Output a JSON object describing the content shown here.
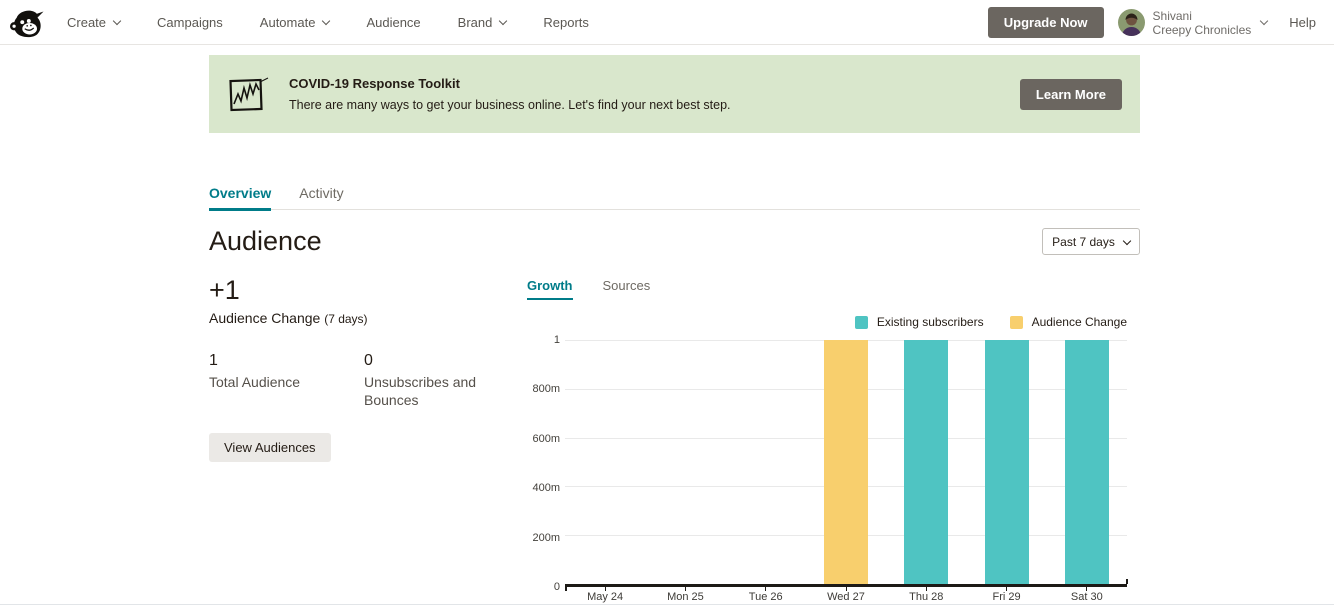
{
  "nav": {
    "items": [
      {
        "label": "Create",
        "chevron": true
      },
      {
        "label": "Campaigns",
        "chevron": false
      },
      {
        "label": "Automate",
        "chevron": true
      },
      {
        "label": "Audience",
        "chevron": false
      },
      {
        "label": "Brand",
        "chevron": true
      },
      {
        "label": "Reports",
        "chevron": false
      }
    ],
    "upgrade_label": "Upgrade Now",
    "user": {
      "name": "Shivani",
      "org": "Creepy Chronicles"
    },
    "help_label": "Help"
  },
  "banner": {
    "icon": "chart-sketch-icon",
    "title": "COVID-19 Response Toolkit",
    "description": "There are many ways to get your business online. Let's find your next best step.",
    "cta": "Learn More",
    "bg_color": "#d9e7cc"
  },
  "tabs": [
    {
      "label": "Overview",
      "active": true
    },
    {
      "label": "Activity",
      "active": false
    }
  ],
  "page": {
    "title": "Audience"
  },
  "range_selector": {
    "value": "Past 7 days",
    "icon": "chevron-down-icon"
  },
  "stats": {
    "change_value": "+1",
    "change_label": "Audience Change",
    "change_period": "(7 days)",
    "items": [
      {
        "value": "1",
        "label": "Total Audience"
      },
      {
        "value": "0",
        "label": "Unsubscribes and Bounces"
      }
    ],
    "view_audiences_label": "View Audiences"
  },
  "chart_tabs": [
    {
      "label": "Growth",
      "active": true
    },
    {
      "label": "Sources",
      "active": false
    }
  ],
  "chart_data": {
    "type": "bar",
    "title": "Audience growth, past 7 days",
    "categories": [
      "May 24",
      "Mon 25",
      "Tue 26",
      "Wed 27",
      "Thu 28",
      "Fri 29",
      "Sat 30"
    ],
    "series": [
      {
        "name": "Existing subscribers",
        "color": "#4fc4c2",
        "values": [
          0,
          0,
          0,
          0,
          1,
          1,
          1
        ]
      },
      {
        "name": "Audience Change",
        "color": "#f8cf6d",
        "values": [
          0,
          0,
          0,
          1,
          0,
          0,
          0
        ]
      }
    ],
    "y_ticks": [
      "1",
      "800m",
      "600m",
      "400m",
      "200m",
      "0"
    ],
    "ylim": [
      0,
      1
    ],
    "grid": true,
    "legend_position": "top-right"
  },
  "colors": {
    "accent_teal": "#007c89",
    "text_dark": "#241c15",
    "dark_button_bg": "#6b6660",
    "light_button_bg": "#ebe9e6",
    "banner_bg": "#d9e7cc",
    "bar_teal": "#4fc4c2",
    "bar_yellow": "#f8cf6d",
    "gridline": "#e9e9e9"
  }
}
